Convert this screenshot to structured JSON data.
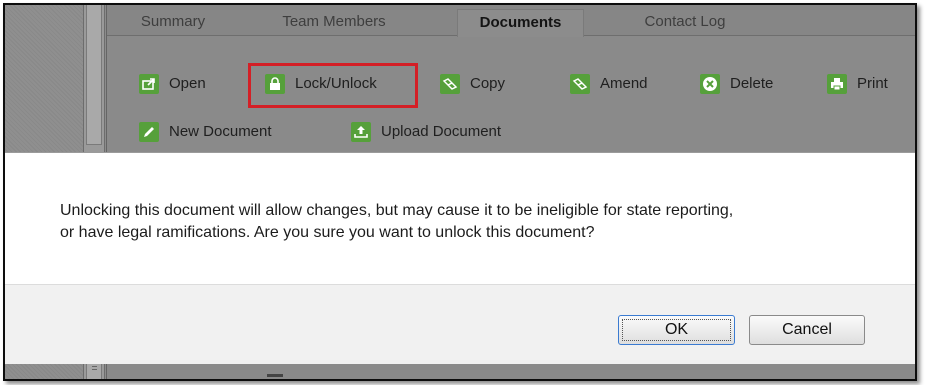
{
  "tabs": [
    {
      "label": "Summary"
    },
    {
      "label": "Team Members"
    },
    {
      "label": "Documents"
    },
    {
      "label": "Contact Log"
    }
  ],
  "toolbar": {
    "open": "Open",
    "lock_unlock": "Lock/Unlock",
    "copy": "Copy",
    "amend": "Amend",
    "delete": "Delete",
    "print": "Print",
    "new_document": "New Document",
    "upload_document": "Upload Document"
  },
  "dialog": {
    "message_line1": "Unlocking this document will allow changes, but may cause it to be ineligible for state reporting,",
    "message_line2": "or have legal ramifications. Are you sure you want to unlock this document?",
    "ok_label": "OK",
    "cancel_label": "Cancel"
  },
  "colors": {
    "icon_green": "#56a03b",
    "highlight_red": "#d41f26"
  }
}
